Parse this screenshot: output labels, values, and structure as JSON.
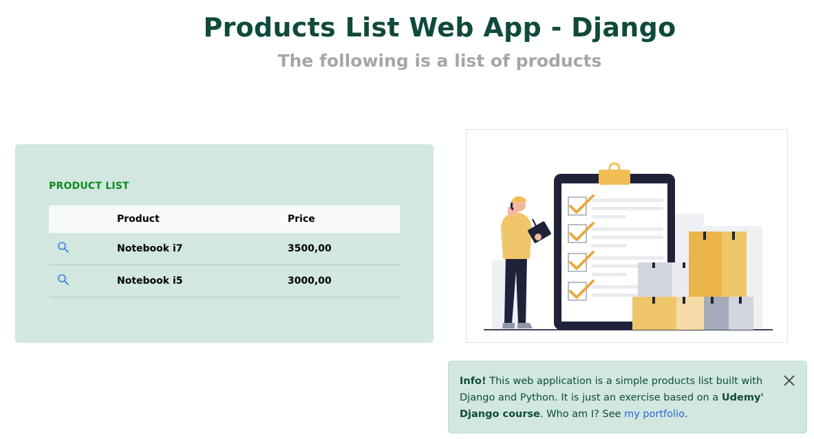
{
  "header": {
    "title": "Products List Web App - Django",
    "subtitle": "The following is a list of products"
  },
  "product_card": {
    "heading": "PRODUCT LIST",
    "columns": [
      "",
      "Product",
      "Price"
    ],
    "rows": [
      {
        "icon": "search-icon",
        "product": "Notebook i7",
        "price": "3500,00"
      },
      {
        "icon": "search-icon",
        "product": "Notebook i5",
        "price": "3000,00"
      }
    ]
  },
  "alert": {
    "label": "Info!",
    "text_1": " This web application is a simple products list built with Django and Python. It is just an exercise based on a ",
    "course": "Udemy' Django course",
    "text_2": ". Who am I? See ",
    "link": "my portfolio",
    "text_3": "."
  },
  "colors": {
    "title": "#0f4a3c",
    "card_bg": "#d1e7df",
    "heading": "#0d8a1c",
    "link": "#2b66d6",
    "accent_yellow": "#f0be55"
  }
}
